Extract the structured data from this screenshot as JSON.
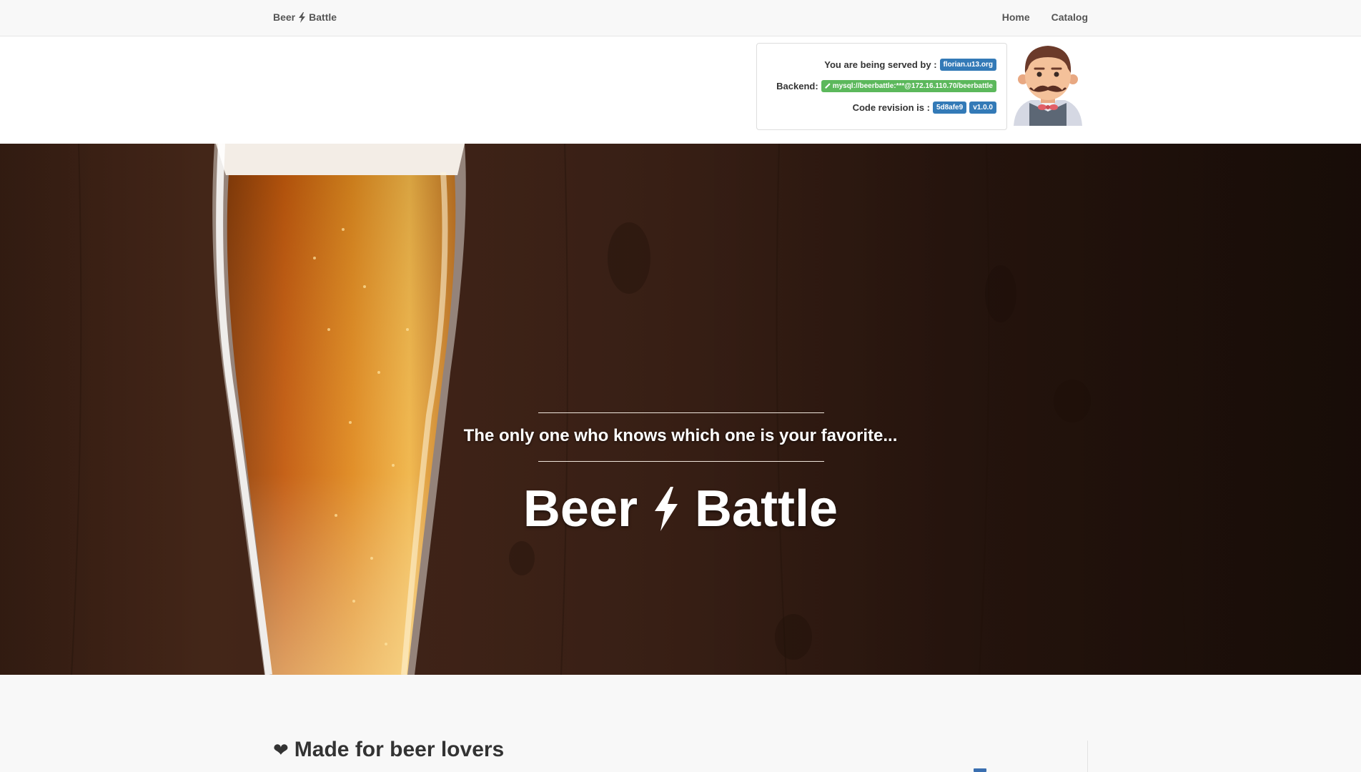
{
  "navbar": {
    "brand_left": "Beer",
    "brand_right": "Battle",
    "links": [
      {
        "label": "Home"
      },
      {
        "label": "Catalog"
      }
    ]
  },
  "info": {
    "served_label": "You are being served by :",
    "served_value": "florian.u13.org",
    "backend_label": "Backend:",
    "backend_value": "mysql://beerbattle:***@172.16.110.70/beerbattle",
    "revision_label": "Code revision is :",
    "revision_hash": "5d8afe9",
    "revision_version": "v1.0.0"
  },
  "hero": {
    "title_left": "Beer",
    "title_right": "Battle",
    "subtitle": "The only one who knows which one is your favorite..."
  },
  "section": {
    "title": "Made for beer lovers"
  },
  "colors": {
    "navbar_bg": "#f8f8f8",
    "badge_blue": "#337ab7",
    "badge_green": "#5cb85c"
  },
  "icons": {
    "brand": "lightning-bolt-icon",
    "backend": "wrench-icon",
    "section": "heart-icon"
  }
}
